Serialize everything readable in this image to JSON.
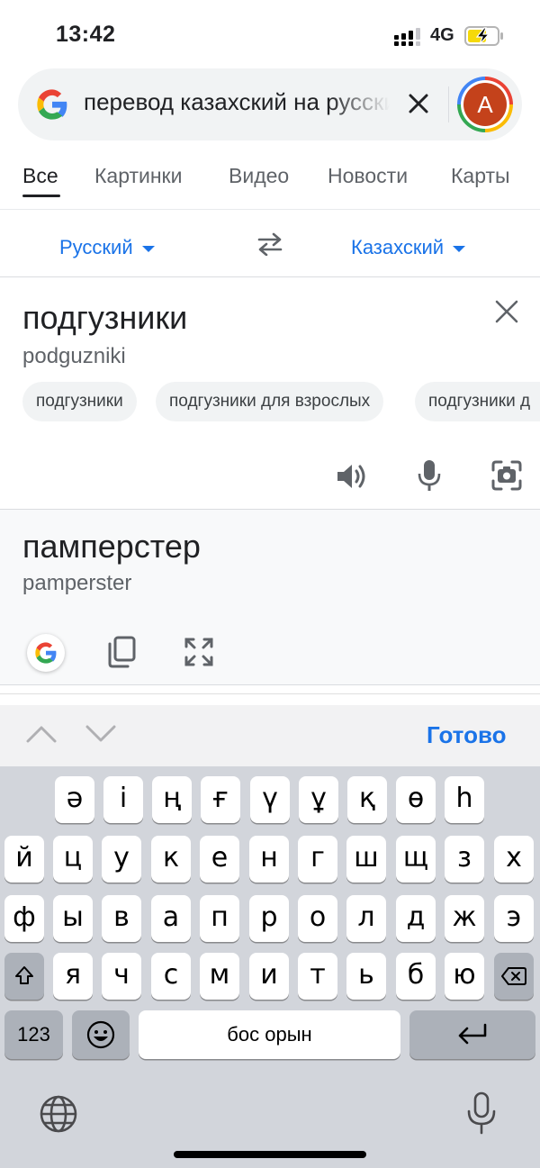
{
  "status_bar": {
    "time": "13:42",
    "network": "4G"
  },
  "search": {
    "query": "перевод казахский на русский",
    "avatar_letter": "A"
  },
  "tabs": [
    {
      "label": "Все"
    },
    {
      "label": "Картинки"
    },
    {
      "label": "Видео"
    },
    {
      "label": "Новости"
    },
    {
      "label": "Карты"
    }
  ],
  "translator": {
    "source_lang": "Русский",
    "target_lang": "Казахский",
    "source_text": "подгузники",
    "source_transliteration": "podguzniki",
    "suggestions": [
      {
        "label": "подгузники"
      },
      {
        "label": "подгузники для взрослых"
      },
      {
        "label": "подгузники д"
      }
    ],
    "result_text": "памперстер",
    "result_transliteration": "pamperster"
  },
  "keyboard_toolbar": {
    "done_label": "Готово"
  },
  "keyboard": {
    "row1": [
      "ә",
      "і",
      "ң",
      "ғ",
      "ү",
      "ұ",
      "қ",
      "ө",
      "һ"
    ],
    "row2": [
      "й",
      "ц",
      "у",
      "к",
      "е",
      "н",
      "г",
      "ш",
      "щ",
      "з",
      "х"
    ],
    "row3": [
      "ф",
      "ы",
      "в",
      "а",
      "п",
      "р",
      "о",
      "л",
      "д",
      "ж",
      "э"
    ],
    "row4": [
      "я",
      "ч",
      "с",
      "м",
      "и",
      "т",
      "ь",
      "б",
      "ю"
    ],
    "numbers_label": "123",
    "space_label": "бос орын"
  },
  "colors": {
    "accent": "#1a73e8",
    "avatar_bg": "#c4421b",
    "keyboard_bg": "#d2d5db"
  }
}
